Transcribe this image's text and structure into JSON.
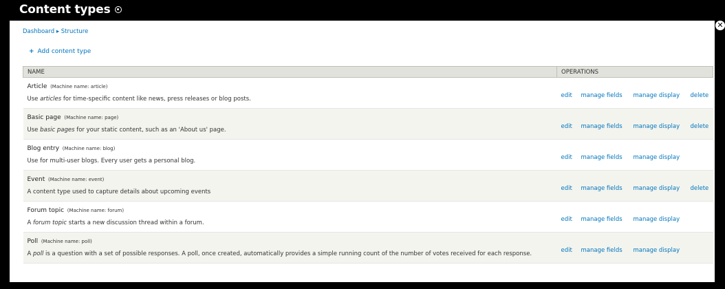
{
  "header": {
    "title": "Content types"
  },
  "breadcrumb": "Dashboard ▸ Structure",
  "actions": {
    "add_label": "Add content type"
  },
  "table": {
    "headers": {
      "name": "NAME",
      "operations": "OPERATIONS"
    },
    "operation_labels": {
      "edit": "edit",
      "manage_fields": "manage fields",
      "manage_display": "manage display",
      "delete": "delete"
    },
    "rows": [
      {
        "name": "Article",
        "machine": "(Machine name: article)",
        "desc_pre": "Use ",
        "desc_em": "articles",
        "desc_post": " for time-specific content like news, press releases or blog posts.",
        "delete": "delete"
      },
      {
        "name": "Basic page",
        "machine": "(Machine name: page)",
        "desc_pre": "Use ",
        "desc_em": "basic pages",
        "desc_post": " for your static content, such as an 'About us' page.",
        "delete": "delete"
      },
      {
        "name": "Blog entry",
        "machine": "(Machine name: blog)",
        "desc_pre": "Use for multi-user blogs. Every user gets a personal blog.",
        "desc_em": "",
        "desc_post": "",
        "delete": ""
      },
      {
        "name": "Event",
        "machine": "(Machine name: event)",
        "desc_pre": "A content type used to capture details about upcoming events",
        "desc_em": "",
        "desc_post": "",
        "delete": "delete"
      },
      {
        "name": "Forum topic",
        "machine": "(Machine name: forum)",
        "desc_pre": "A ",
        "desc_em": "forum topic",
        "desc_post": " starts a new discussion thread within a forum.",
        "delete": ""
      },
      {
        "name": "Poll",
        "machine": "(Machine name: poll)",
        "desc_pre": "A ",
        "desc_em": "poll",
        "desc_post": " is a question with a set of possible responses. A poll, once created, automatically provides a simple running count of the number of votes received for each response.",
        "delete": ""
      }
    ]
  },
  "colors": {
    "link": "#0074bd",
    "header_bg": "#e1e2dc",
    "stripe": "#f3f4ee"
  },
  "icons": {
    "shortcut": "shortcut-toggle-icon",
    "close": "close-icon",
    "add": "plus-icon"
  }
}
